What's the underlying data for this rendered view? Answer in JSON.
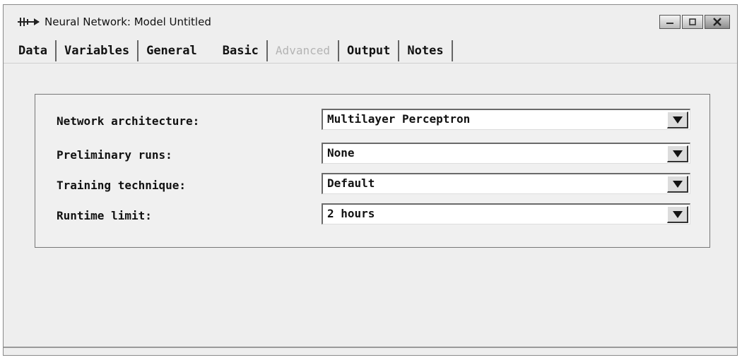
{
  "window": {
    "title": "Neural Network: Model Untitled",
    "icons": {
      "app": "network-arrow-icon",
      "minimize": "minimize-icon",
      "maximize": "maximize-icon",
      "close": "close-icon"
    }
  },
  "tabs": [
    {
      "label": "Data",
      "enabled": true
    },
    {
      "label": "Variables",
      "enabled": true
    },
    {
      "label": "General",
      "enabled": true
    },
    {
      "label": "Basic",
      "enabled": true
    },
    {
      "label": "Advanced",
      "enabled": false
    },
    {
      "label": "Output",
      "enabled": true
    },
    {
      "label": "Notes",
      "enabled": true
    }
  ],
  "settings": [
    {
      "label": "Network architecture:",
      "value": "Multilayer Perceptron"
    },
    {
      "label": "Preliminary runs:",
      "value": "None"
    },
    {
      "label": "Training technique:",
      "value": "Default"
    },
    {
      "label": "Runtime limit:",
      "value": "2 hours"
    }
  ],
  "dropdown_icon": "triangle-down-icon"
}
